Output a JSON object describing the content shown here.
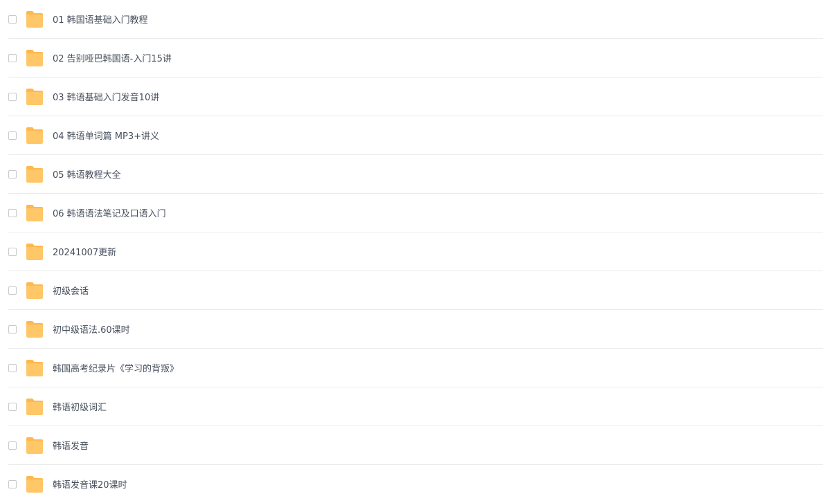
{
  "file_list": {
    "items": [
      {
        "name": "01 韩国语基础入门教程",
        "icon": "folder-icon"
      },
      {
        "name": "02 告别哑巴韩国语-入门15讲",
        "icon": "folder-icon"
      },
      {
        "name": "03 韩语基础入门发音10讲",
        "icon": "folder-icon"
      },
      {
        "name": "04 韩语单词篇 MP3+讲义",
        "icon": "folder-icon"
      },
      {
        "name": "05 韩语教程大全",
        "icon": "folder-icon"
      },
      {
        "name": "06 韩语语法笔记及口语入门",
        "icon": "folder-icon"
      },
      {
        "name": "20241007更新",
        "icon": "folder-icon"
      },
      {
        "name": "初级会话",
        "icon": "folder-icon"
      },
      {
        "name": "初中级语法.60课时",
        "icon": "folder-icon"
      },
      {
        "name": "韩国高考纪录片《学习的背叛》",
        "icon": "folder-icon"
      },
      {
        "name": "韩语初级词汇",
        "icon": "folder-icon"
      },
      {
        "name": "韩语发音",
        "icon": "folder-icon"
      },
      {
        "name": "韩语发音课20课时",
        "icon": "folder-icon"
      }
    ]
  },
  "colors": {
    "folder_fill": "#ffc768",
    "folder_tab": "#ffb84d",
    "text": "#454d5a",
    "divider": "#ebebeb",
    "checkbox_border": "#c9c9c9"
  }
}
